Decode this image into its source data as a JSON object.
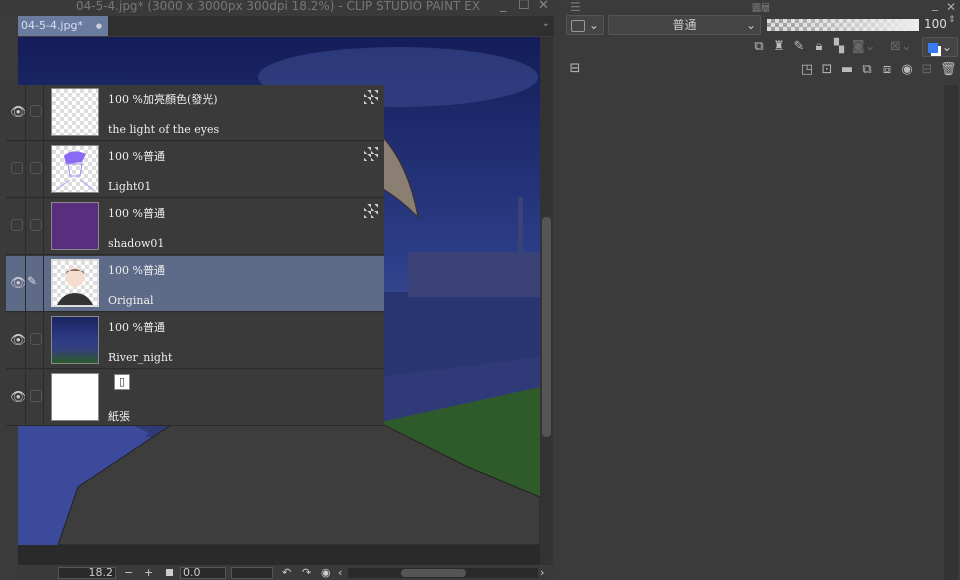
{
  "window": {
    "title": "04-5-4.jpg* (3000 x 3000px 300dpi 18.2%)  - CLIP STUDIO PAINT EX",
    "minimize": "_",
    "maximize": "☐",
    "close": "✕"
  },
  "tab": {
    "label": "04-5-4.jpg*",
    "dot": "●"
  },
  "bottom": {
    "zoom": "18.2",
    "minus": "−",
    "plus": "+",
    "angle": "0.0"
  },
  "panel": {
    "title": "圖層",
    "blend_mode": "普通",
    "opacity": "100",
    "close": "✕",
    "minimize": "_"
  },
  "layers": [
    {
      "mode": "100 %加亮顏色(發光)",
      "name": "the light of the eyes",
      "visible": true,
      "locked": true,
      "thumb": "transparent"
    },
    {
      "mode": "100 %普通",
      "name": "Light01",
      "visible": false,
      "locked": true,
      "thumb": "light"
    },
    {
      "mode": "100 %普通",
      "name": "shadow01",
      "visible": false,
      "locked": true,
      "thumb": "purple"
    },
    {
      "mode": "100 %普通",
      "name": "Original",
      "visible": true,
      "locked": false,
      "selected": true,
      "thumb": "character"
    },
    {
      "mode": "100 %普通",
      "name": "River_night",
      "visible": true,
      "locked": false,
      "thumb": "night"
    },
    {
      "mode": "",
      "name": "紙張",
      "visible": true,
      "locked": false,
      "thumb": "paper"
    }
  ],
  "colors": {
    "accent": "#5d6a88",
    "tab": "#6a7ba0"
  }
}
